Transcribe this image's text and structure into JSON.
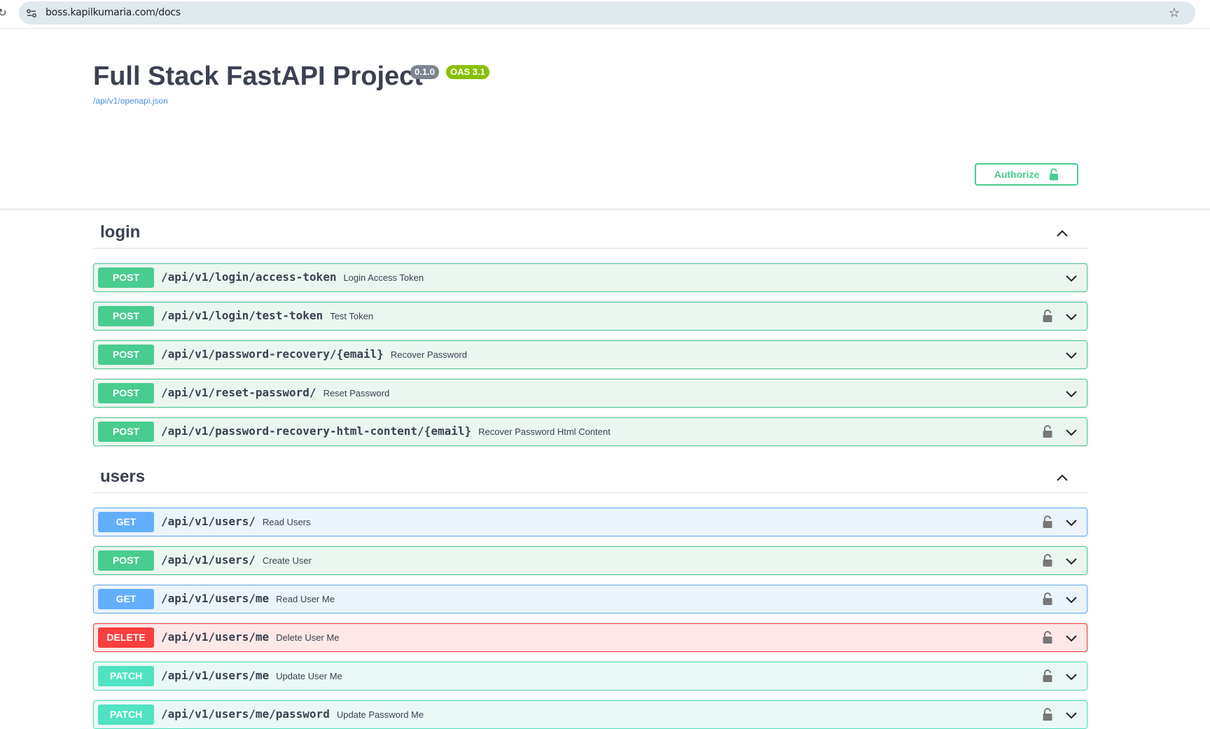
{
  "browser": {
    "url": "boss.kapilkumaria.com/docs"
  },
  "info": {
    "title": "Full Stack FastAPI Project",
    "version": "0.1.0",
    "oas": "OAS 3.1",
    "spec_link": "/api/v1/openapi.json"
  },
  "auth": {
    "label": "Authorize"
  },
  "colors": {
    "post": "#49cc90",
    "get": "#61affe",
    "delete": "#f93e3e",
    "patch": "#50e3c2"
  },
  "tags": [
    {
      "name": "login",
      "expanded": true,
      "operations": [
        {
          "method": "POST",
          "path": "/api/v1/login/access-token",
          "summary": "Login Access Token",
          "locked": false
        },
        {
          "method": "POST",
          "path": "/api/v1/login/test-token",
          "summary": "Test Token",
          "locked": true
        },
        {
          "method": "POST",
          "path": "/api/v1/password-recovery/{email}",
          "summary": "Recover Password",
          "locked": false
        },
        {
          "method": "POST",
          "path": "/api/v1/reset-password/",
          "summary": "Reset Password",
          "locked": false
        },
        {
          "method": "POST",
          "path": "/api/v1/password-recovery-html-content/{email}",
          "summary": "Recover Password Html Content",
          "locked": true
        }
      ]
    },
    {
      "name": "users",
      "expanded": true,
      "operations": [
        {
          "method": "GET",
          "path": "/api/v1/users/",
          "summary": "Read Users",
          "locked": true
        },
        {
          "method": "POST",
          "path": "/api/v1/users/",
          "summary": "Create User",
          "locked": true
        },
        {
          "method": "GET",
          "path": "/api/v1/users/me",
          "summary": "Read User Me",
          "locked": true
        },
        {
          "method": "DELETE",
          "path": "/api/v1/users/me",
          "summary": "Delete User Me",
          "locked": true
        },
        {
          "method": "PATCH",
          "path": "/api/v1/users/me",
          "summary": "Update User Me",
          "locked": true
        },
        {
          "method": "PATCH",
          "path": "/api/v1/users/me/password",
          "summary": "Update Password Me",
          "locked": true
        }
      ]
    }
  ]
}
